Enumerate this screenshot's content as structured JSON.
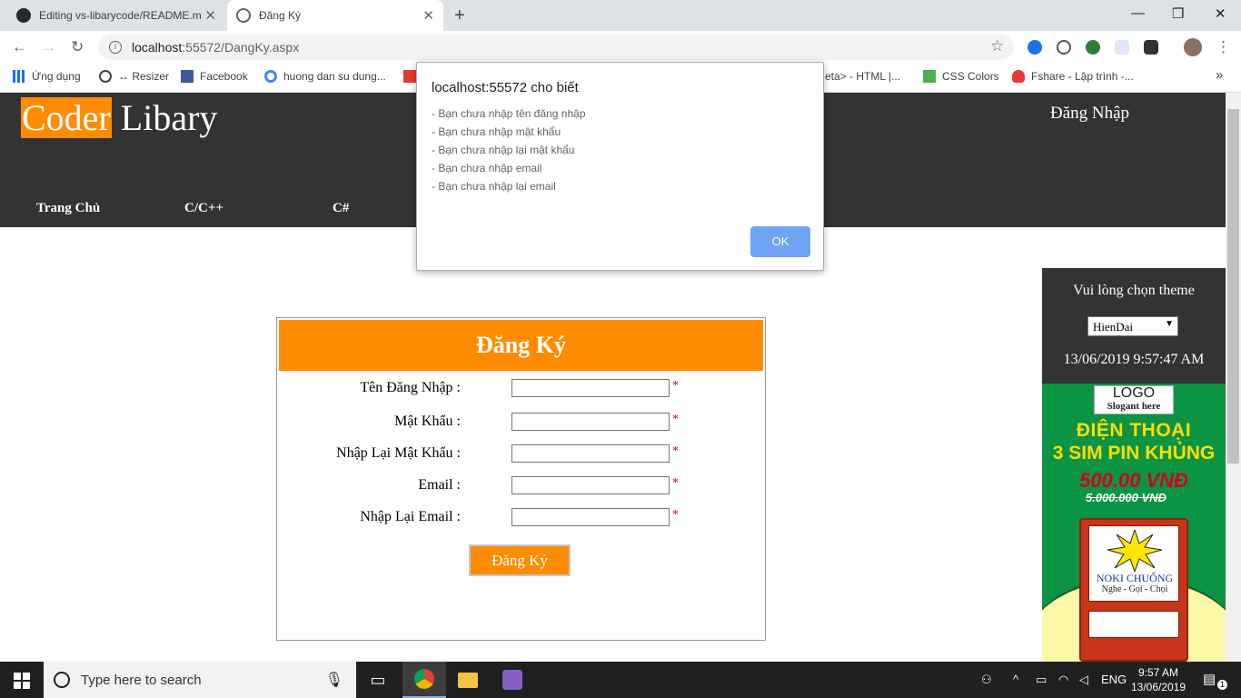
{
  "browser": {
    "tabs": [
      {
        "title": "Editing vs-libarycode/README.m",
        "favicon": "github-icon",
        "active": false
      },
      {
        "title": "Đăng Ký",
        "favicon": "globe-icon",
        "active": true
      }
    ],
    "url_host": "localhost",
    "url_path": ":55572/DangKy.aspx",
    "bookmarks": [
      {
        "label": "Ứng dụng",
        "icon": "apps-grid-icon"
      },
      {
        "label": "↔ Resizer",
        "icon": "resizer-icon"
      },
      {
        "label": "Facebook",
        "icon": "facebook-icon"
      },
      {
        "label": "huong dan su dung...",
        "icon": "google-icon"
      },
      {
        "label": "eta> - HTML |...",
        "icon": "page-icon"
      },
      {
        "label": "CSS Colors",
        "icon": "w3-icon"
      },
      {
        "label": "Fshare - Lập trình -...",
        "icon": "cloud-icon"
      }
    ],
    "more_bookmarks": "»"
  },
  "site": {
    "logo_highlight": "Coder",
    "logo_rest": " Libary",
    "login_link": "Đăng Nhập",
    "nav": [
      "Trang Chủ",
      "C/C++",
      "C#"
    ],
    "theme_label": "Vui lòng chọn theme",
    "theme_selected": "HienDai",
    "clock": "13/06/2019 9:57:47 AM"
  },
  "ad": {
    "logo": "LOGO",
    "slogan_here": "Slogant here",
    "line1": "ĐIỆN THOẠI",
    "line2": "3 SIM PIN KHỦNG",
    "price": "500.00 VNĐ",
    "old_price": "5.000.000 VNĐ",
    "brand": "NOKI CHUỐNG",
    "tagline": "Nghe - Gọi - Chọi"
  },
  "form": {
    "title": "Đăng Ký",
    "fields": [
      {
        "label": "Tên Đăng Nhập :",
        "value": ""
      },
      {
        "label": "Mật Khẩu :",
        "value": ""
      },
      {
        "label": "Nhập Lại Mật Khẩu :",
        "value": ""
      },
      {
        "label": "Email :",
        "value": ""
      },
      {
        "label": "Nhập Lại Email :",
        "value": ""
      }
    ],
    "required_mark": "*",
    "submit": "Đăng Ký"
  },
  "alert": {
    "title": "localhost:55572 cho biết",
    "lines": [
      "- Bạn chưa nhập tên đăng nhập",
      "- Bạn chưa nhập mật khẩu",
      "- Bạn chưa nhập lại mật khẩu",
      "- Bạn chưa nhập email",
      "- Bạn chưa nhập lại email"
    ],
    "ok": "OK"
  },
  "taskbar": {
    "search_placeholder": "Type here to search",
    "lang": "ENG",
    "time": "9:57 AM",
    "date": "13/06/2019",
    "notification_count": "1"
  },
  "colors": {
    "accent_orange": "#ff8c00",
    "header_dark": "#333333",
    "ok_button": "#6fa3f5",
    "required_red": "#dd0000"
  }
}
